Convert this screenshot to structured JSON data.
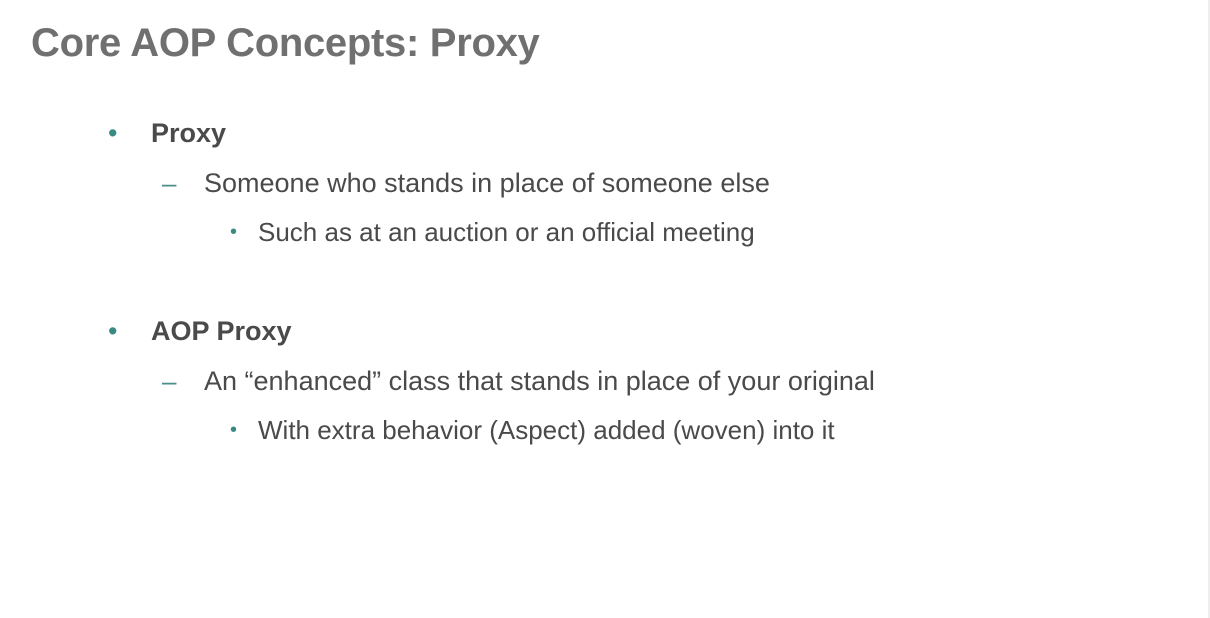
{
  "slide": {
    "title": "Core AOP Concepts: Proxy",
    "bullets": [
      {
        "heading": "Proxy",
        "sub": "Someone who stands in place of  someone else",
        "detail": "Such as at an auction or an official meeting"
      },
      {
        "heading": "AOP Proxy",
        "sub": "An “enhanced” class that stands in place of  your original",
        "detail": "With extra behavior (Aspect) added (woven) into it"
      }
    ],
    "markers": {
      "level1": "•",
      "level2": "–",
      "level3": "•"
    }
  },
  "colors": {
    "title": "#707070",
    "body_text": "#4a4a4a",
    "accent_bullet": "#3a8a84"
  }
}
